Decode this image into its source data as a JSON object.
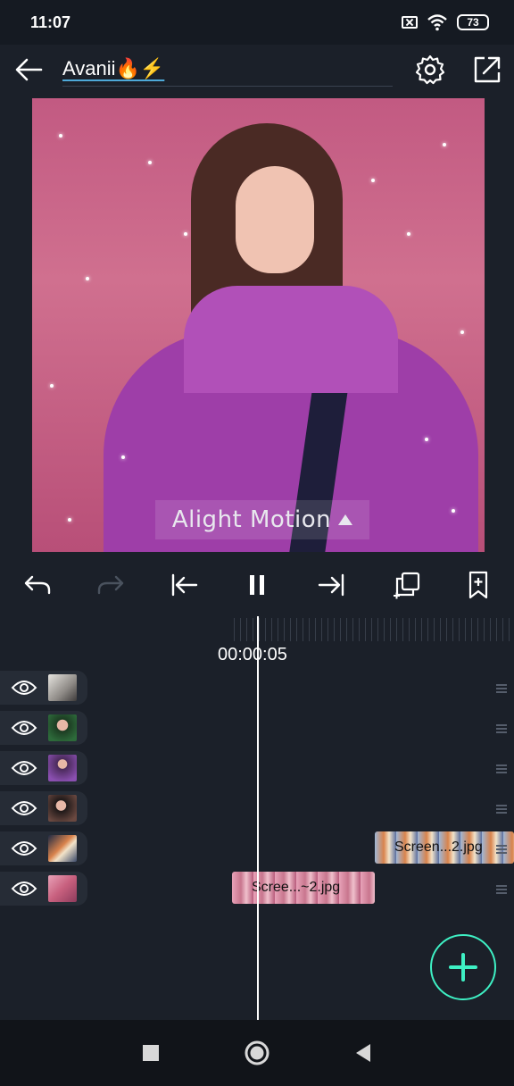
{
  "status_bar": {
    "time": "11:07",
    "battery": "73",
    "icons": [
      "sim-off-icon",
      "wifi-icon",
      "battery-icon"
    ]
  },
  "header": {
    "title": "Avanii🔥⚡",
    "back_icon": "arrow-left-icon",
    "settings_icon": "gear-icon",
    "export_icon": "export-icon"
  },
  "preview": {
    "watermark": "Alight Motion"
  },
  "playback": {
    "buttons": [
      "undo-icon",
      "redo-icon",
      "skip-start-icon",
      "pause-icon",
      "skip-end-icon",
      "duplicate-icon",
      "bookmark-add-icon"
    ]
  },
  "timeline": {
    "timecode": "00:00:05",
    "layers": [
      {
        "visible": true,
        "thumb_color": "#c9c6c0"
      },
      {
        "visible": true,
        "thumb_color": "#2d6a3a"
      },
      {
        "visible": true,
        "thumb_color": "#8a4fb0"
      },
      {
        "visible": true,
        "thumb_color": "#4b3b38"
      },
      {
        "visible": true,
        "thumb_color": "#3b4a6a"
      },
      {
        "visible": true,
        "thumb_color": "#c8607e"
      }
    ],
    "clips": [
      {
        "label": "Screen...2.jpg"
      },
      {
        "label": "Scree...~2.jpg"
      }
    ]
  },
  "colors": {
    "accent": "#3ef0c4",
    "background": "#1b2029"
  },
  "fab": {
    "icon": "plus-icon"
  },
  "navbar": {
    "buttons": [
      "recents-icon",
      "home-icon",
      "back-icon"
    ]
  }
}
